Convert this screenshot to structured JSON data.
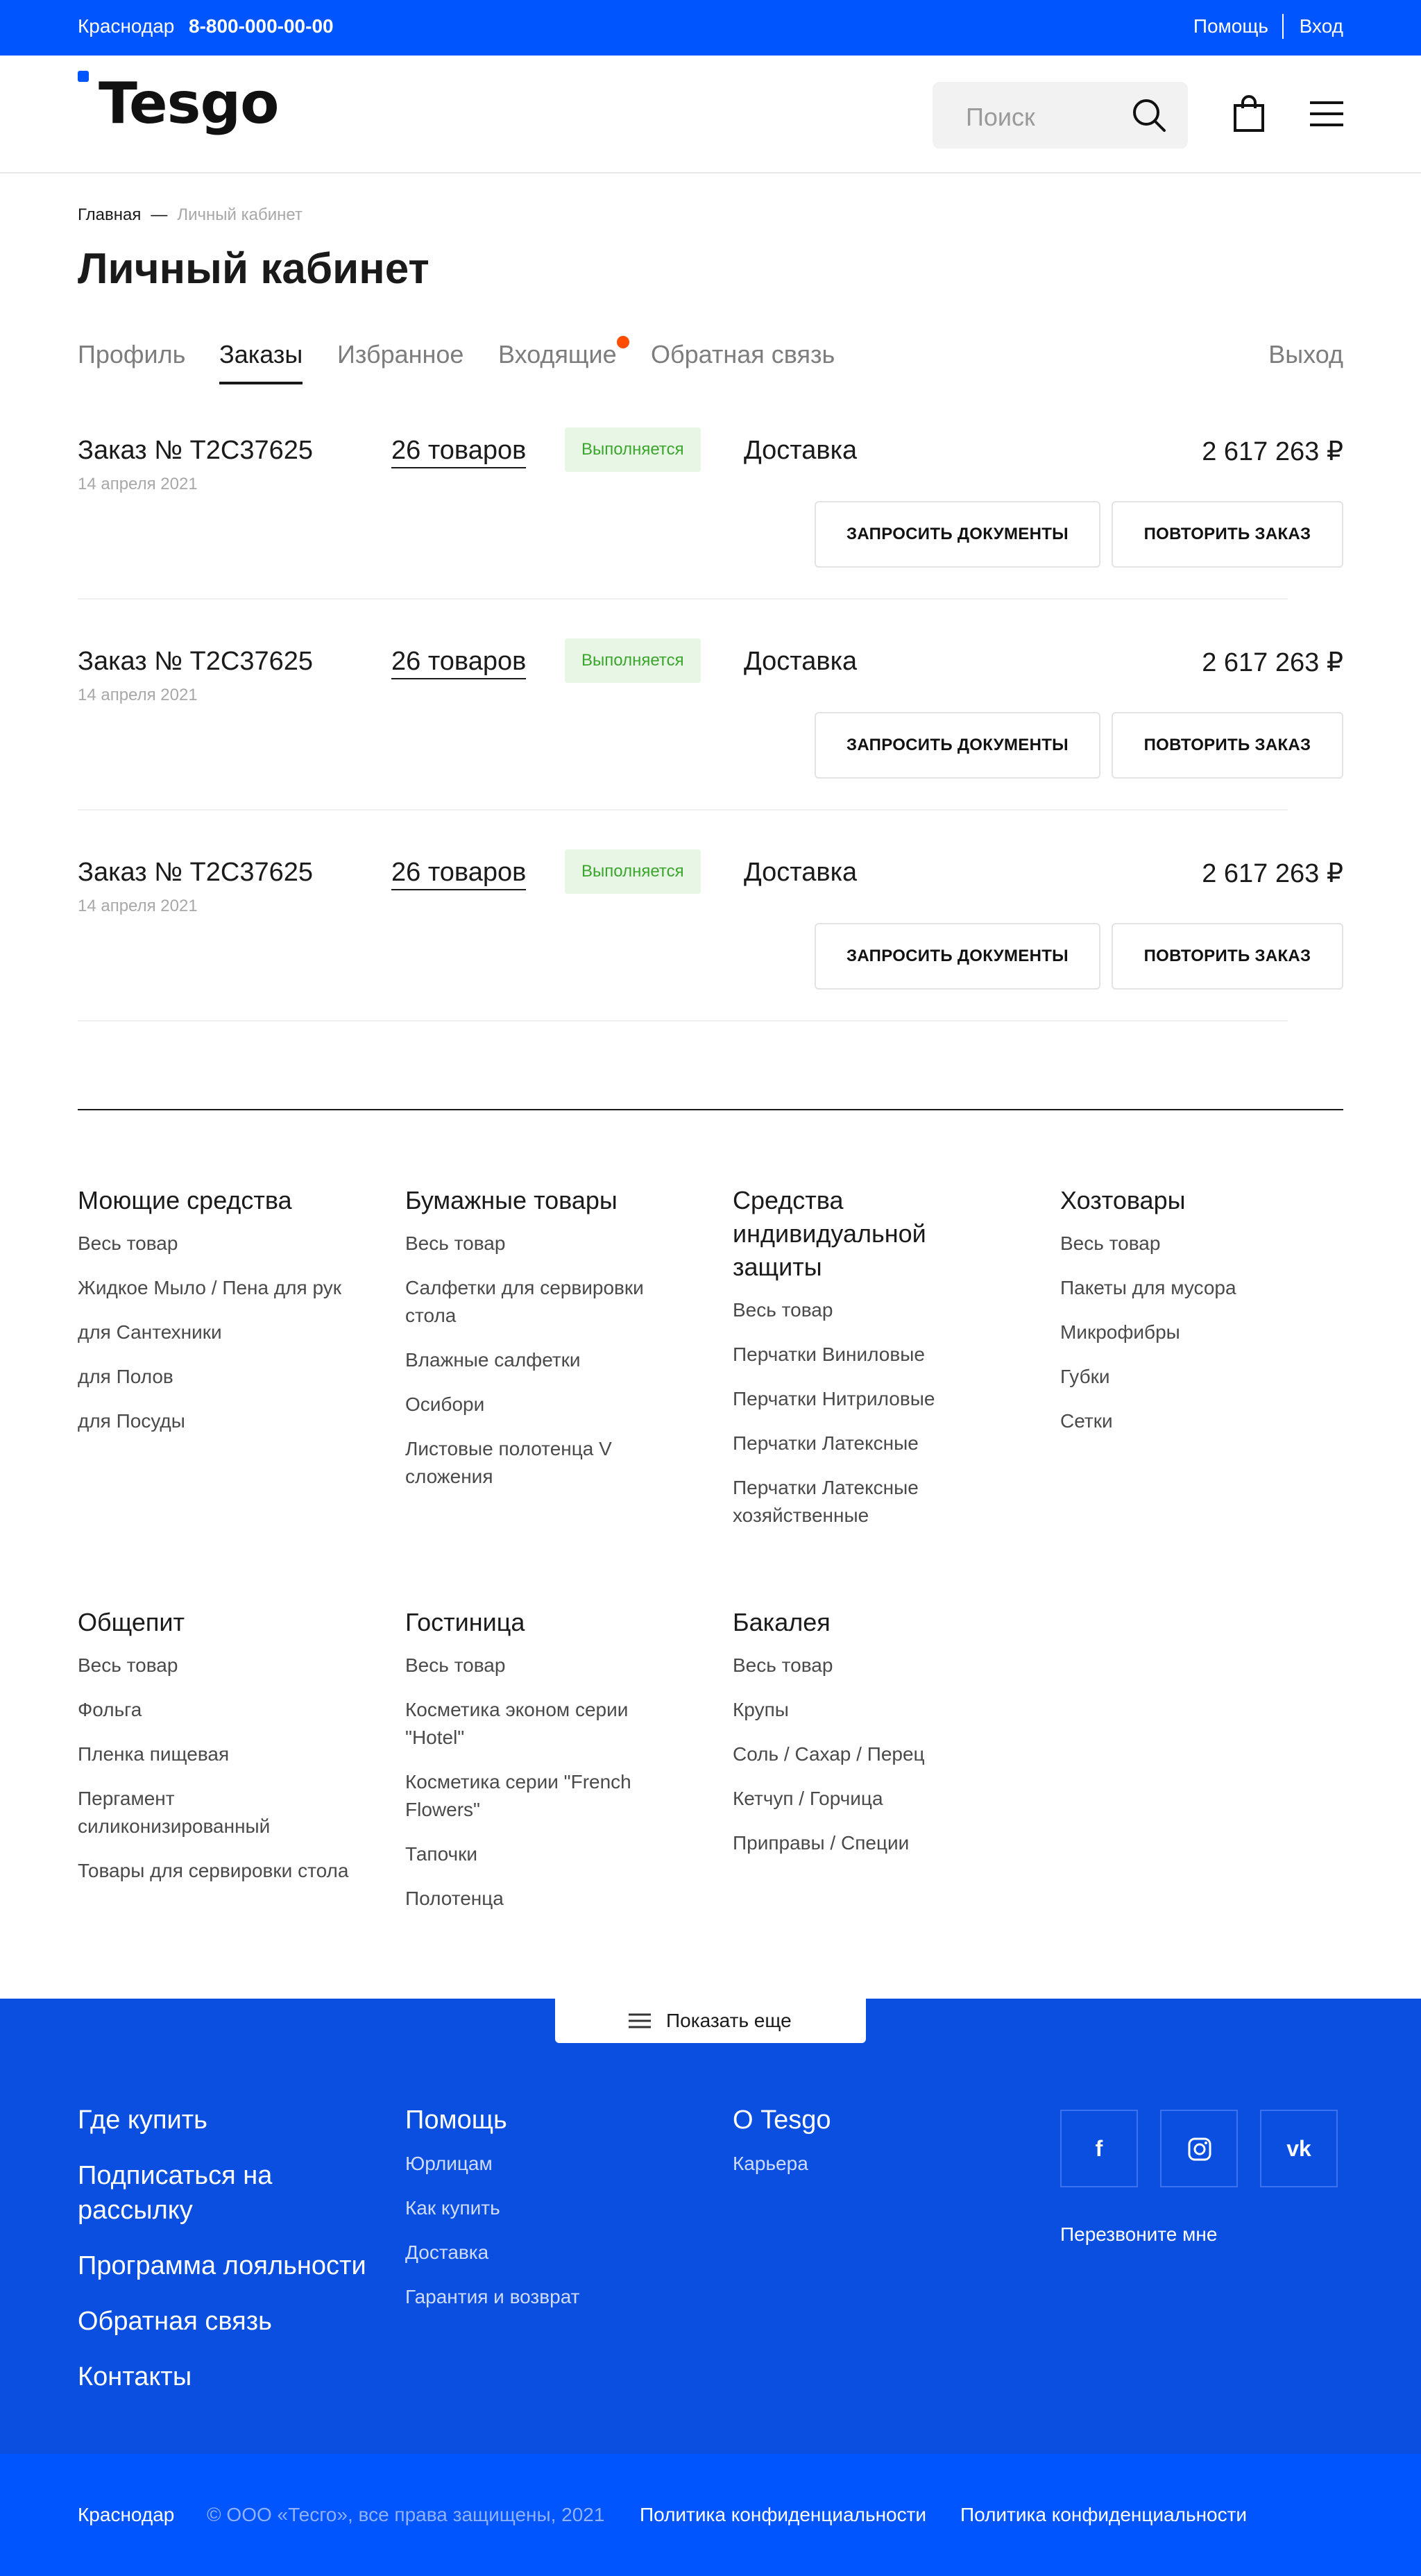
{
  "topbar": {
    "city": "Краснодар",
    "phone": "8-800-000-00-00",
    "help": "Помощь",
    "login": "Вход"
  },
  "header": {
    "logo": "Tesgo",
    "search_placeholder": "Поиск",
    "icons": [
      "search-icon",
      "cart-icon",
      "menu-icon"
    ]
  },
  "breadcrumb": {
    "home": "Главная",
    "separator": "—",
    "current": "Личный кабинет"
  },
  "page_title": "Личный кабинет",
  "tabs": [
    {
      "label": "Профиль"
    },
    {
      "label": "Заказы"
    },
    {
      "label": "Избранное"
    },
    {
      "label": "Входящие"
    },
    {
      "label": "Обратная связь"
    }
  ],
  "active_tab": "Заказы",
  "logout": "Выход",
  "orders": [
    {
      "number": "Заказ № T2C37625",
      "date": "14 апреля 2021",
      "items": "26 товаров",
      "status": "Выполняется",
      "delivery": "Доставка",
      "price": "2 617 263 ₽",
      "docs_button": "ЗАПРОСИТЬ ДОКУМЕНТЫ",
      "repeat_button": "ПОВТОРИТЬ ЗАКАЗ"
    },
    {
      "number": "Заказ № T2C37625",
      "date": "14 апреля 2021",
      "items": "26 товаров",
      "status": "Выполняется",
      "delivery": "Доставка",
      "price": "2 617 263 ₽",
      "docs_button": "ЗАПРОСИТЬ ДОКУМЕНТЫ",
      "repeat_button": "ПОВТОРИТЬ ЗАКАЗ"
    },
    {
      "number": "Заказ № T2C37625",
      "date": "14 апреля 2021",
      "items": "26 товаров",
      "status": "Выполняется",
      "delivery": "Доставка",
      "price": "2 617 263 ₽",
      "docs_button": "ЗАПРОСИТЬ ДОКУМЕНТЫ",
      "repeat_button": "ПОВТОРИТЬ ЗАКАЗ"
    }
  ],
  "catalog": [
    {
      "title": "Моющие средства",
      "links": [
        "Весь товар",
        "Жидкое Мыло / Пена для рук",
        "для Сантехники",
        "для Полов",
        "для Посуды"
      ]
    },
    {
      "title": "Бумажные товары",
      "links": [
        "Весь товар",
        "Салфетки для сервировки стола",
        "Влажные салфетки",
        "Осибори",
        "Листовые полотенца V сложения"
      ]
    },
    {
      "title": "Средства индивидуальной защиты",
      "links": [
        "Весь товар",
        "Перчатки Виниловые",
        "Перчатки Нитриловые",
        "Перчатки Латексные",
        "Перчатки Латексные хозяйственные"
      ]
    },
    {
      "title": "Хозтовары",
      "links": [
        "Весь товар",
        "Пакеты для мусора",
        "Микрофибры",
        "Губки",
        "Сетки"
      ]
    },
    {
      "title": "Общепит",
      "links": [
        "Весь товар",
        "Фольга",
        "Пленка пищевая",
        "Пергамент силиконизированный",
        "Товары для сервировки стола"
      ]
    },
    {
      "title": "Гостиница",
      "links": [
        "Весь товар",
        "Косметика эконом серии \"Hotel\"",
        "Косметика серии \"French Flowers\"",
        "Тапочки",
        "Полотенца"
      ]
    },
    {
      "title": "Бакалея",
      "links": [
        "Весь товар",
        "Крупы",
        "Соль / Сахар / Перец",
        "Кетчуп / Горчица",
        "Приправы / Специи"
      ]
    }
  ],
  "show_more": "Показать еще",
  "footer": {
    "main_links": [
      "Где купить",
      "Подписаться на рассылку",
      "Программа лояльности",
      "Обратная связь",
      "Контакты"
    ],
    "help": {
      "title": "Помощь",
      "links": [
        "Юрлицам",
        "Как купить",
        "Доставка",
        "Гарантия и возврат"
      ]
    },
    "about": {
      "title": "О Tesgo",
      "links": [
        "Карьера"
      ]
    },
    "social": [
      {
        "icon": "facebook-icon",
        "glyph": "f"
      },
      {
        "icon": "instagram-icon",
        "glyph": ""
      },
      {
        "icon": "vk-icon",
        "glyph": "vk"
      }
    ],
    "callback": "Перезвоните мне"
  },
  "bottom": {
    "city": "Краснодар",
    "copyright": "© ООО «Тесго», все права защищены, 2021",
    "privacy1": "Политика конфиденциальности",
    "privacy2": "Политика конфиденциальности"
  },
  "colors": {
    "brand_blue": "#0055ff",
    "footer_blue": "#0a4fe0",
    "status_green": "#3aa62c",
    "status_bg": "#e8f7e5",
    "notification_dot": "#ff4d00"
  }
}
